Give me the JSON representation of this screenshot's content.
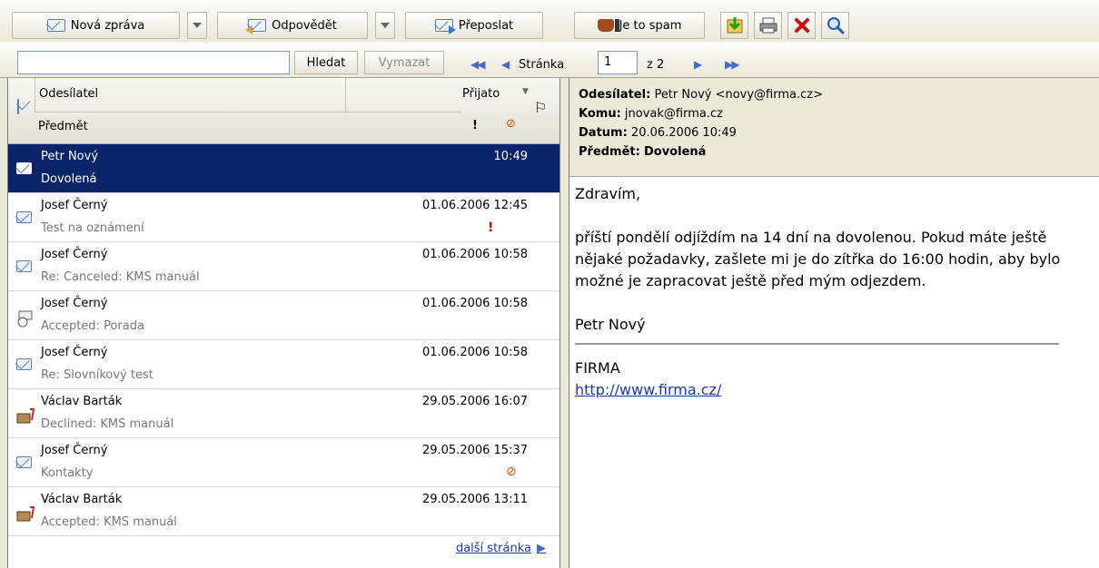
{
  "toolbar": {
    "new_message": "Nová zpráva",
    "reply": "Odpovědět",
    "forward": "Přeposlat",
    "spam": "Je to spam"
  },
  "search": {
    "value": "",
    "find_label": "Hledat",
    "clear_label": "Vymazat"
  },
  "pager": {
    "page_label": "Stránka",
    "current_page": "1",
    "of_label": "z 2"
  },
  "list": {
    "col_sender": "Odesílatel",
    "col_received": "Přijato",
    "col_subject": "Předmět",
    "col_priority": "!",
    "next_page": "další stránka",
    "rows": [
      {
        "from": "Petr Nový",
        "subject": "Dovolená",
        "date": "10:49",
        "selected": true,
        "icon": "open-envelope-icon"
      },
      {
        "from": "Josef Černý",
        "subject": "Test na oznámení",
        "date": "01.06.2006 12:45",
        "important": "!",
        "icon": "envelope-icon"
      },
      {
        "from": "Josef Černý",
        "subject": "Re: Canceled: KMS manuál",
        "date": "01.06.2006 10:58",
        "icon": "envelope-icon"
      },
      {
        "from": "Josef Černý",
        "subject": "Accepted: Porada",
        "date": "01.06.2006 10:58",
        "icon": "meeting-accepted-icon"
      },
      {
        "from": "Josef Černý",
        "subject": "Re: Slovníkový test",
        "date": "01.06.2006 10:58",
        "icon": "envelope-icon"
      },
      {
        "from": "Václav Barták",
        "subject": "Declined: KMS manuál",
        "date": "29.05.2006 16:07",
        "icon": "meeting-response-icon"
      },
      {
        "from": "Josef Černý",
        "subject": "Kontakty",
        "date": "29.05.2006 15:37",
        "attachment": true,
        "icon": "envelope-icon"
      },
      {
        "from": "Václav Barták",
        "subject": "Accepted: KMS manuál",
        "date": "29.05.2006 13:11",
        "icon": "meeting-response-icon"
      }
    ]
  },
  "preview": {
    "sender_label": "Odesílatel:",
    "sender_value": "Petr Nový <novy@firma.cz>",
    "to_label": "Komu:",
    "to_value": "jnovak@firma.cz",
    "date_label": "Datum:",
    "date_value": "20.06.2006 10:49",
    "subject_label": "Předmět:",
    "subject_value": "Dovolená",
    "greeting": "Zdravím,",
    "body": "příští pondělí odjíždím na 14 dní na dovolenou. Pokud máte ještě nějaké požadavky, zašlete mi je do zítřka do 16:00 hodin, aby bylo možné je zapracovat ještě před mým odjezdem.",
    "signature": "Petr Nový",
    "company": "FIRMA",
    "url": "http://www.firma.cz/"
  },
  "colors": {
    "selection": "#0a246a",
    "link": "#1a3aa0",
    "important": "#e00000",
    "attachment": "#e05000"
  }
}
